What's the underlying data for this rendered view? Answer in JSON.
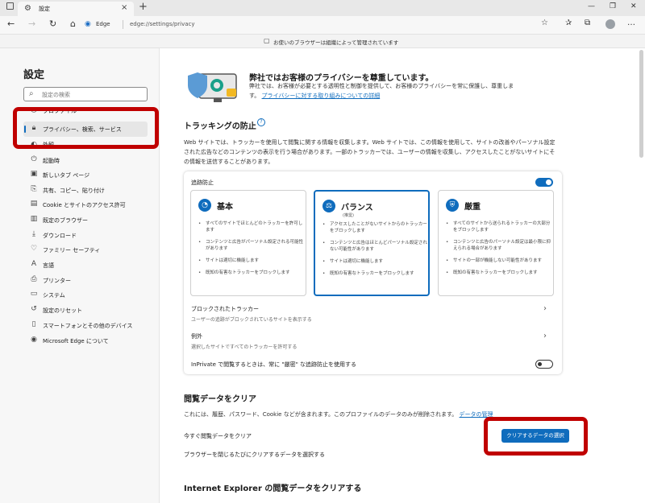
{
  "browser": {
    "tab_title": "設定",
    "address_host": "Edge",
    "address_url": "edge://settings/privacy",
    "managed_notice": "お使いのブラウザーは組織によって管理されています"
  },
  "sidebar": {
    "title": "設定",
    "search_placeholder": "設定の検索",
    "items": [
      {
        "label": "プロファイル",
        "icon": "profile-icon"
      },
      {
        "label": "プライバシー、検索、サービス",
        "icon": "lock-icon",
        "active": true
      },
      {
        "label": "外観",
        "icon": "appearance-icon"
      },
      {
        "label": "起動時",
        "icon": "power-icon"
      },
      {
        "label": "新しいタブ ページ",
        "icon": "newtab-icon"
      },
      {
        "label": "共有、コピー、貼り付け",
        "icon": "share-icon"
      },
      {
        "label": "Cookie とサイトのアクセス許可",
        "icon": "cookie-icon"
      },
      {
        "label": "既定のブラウザー",
        "icon": "browser-icon"
      },
      {
        "label": "ダウンロード",
        "icon": "download-icon"
      },
      {
        "label": "ファミリー セーフティ",
        "icon": "family-icon"
      },
      {
        "label": "言語",
        "icon": "language-icon"
      },
      {
        "label": "プリンター",
        "icon": "printer-icon"
      },
      {
        "label": "システム",
        "icon": "system-icon"
      },
      {
        "label": "設定のリセット",
        "icon": "reset-icon"
      },
      {
        "label": "スマートフォンとその他のデバイス",
        "icon": "phone-icon"
      },
      {
        "label": "Microsoft Edge について",
        "icon": "edge-icon"
      }
    ]
  },
  "hero": {
    "title": "弊社ではお客様のプライバシーを尊重しています。",
    "desc": "弊社では、お客様が必要とする透明性と制御を提供して、お客様のプライバシーを常に保護し、尊重します。",
    "link": "プライバシーに対する取り組みについての詳細"
  },
  "tracking": {
    "heading": "トラッキングの防止",
    "desc": "Web サイトでは、トラッカーを使用して閲覧に関する情報を収集します。Web サイトでは、この情報を使用して、サイトの改善やパーソナル設定された広告などのコンテンツの表示を行う場合があります。一部のトラッカーでは、ユーザーの情報を収集し、アクセスしたことがないサイトにその情報を送信することがあります。",
    "toggle_label": "追跡防止",
    "options": [
      {
        "name": "基本",
        "sub": "",
        "icon": "basic-icon",
        "bullets": [
          "すべてのサイトでほとんどのトラッカーを許可します",
          "コンテンツと広告がパーソナル設定される可能性があります",
          "サイトは適切に機能します",
          "既知の有害なトラッカーをブロックします"
        ]
      },
      {
        "name": "バランス",
        "sub": "(推奨)",
        "icon": "balance-icon",
        "bullets": [
          "アクセスしたことがないサイトからのトラッカーをブロックします",
          "コンテンツと広告はほとんどパーソナル設定されない可能性があります",
          "サイトは適切に機能します",
          "既知の有害なトラッカーをブロックします"
        ]
      },
      {
        "name": "厳重",
        "sub": "",
        "icon": "strict-icon",
        "bullets": [
          "すべてのサイトから送られるトラッカーの大部分をブロックします",
          "コンテンツと広告のパーソナル設定は最小限に抑えられる場合があります",
          "サイトの一部が機能しない可能性があります",
          "既知の有害なトラッカーをブロックします"
        ]
      }
    ],
    "blocked_title": "ブロックされたトラッカー",
    "blocked_sub": "ユーザーの追跡がブロックされているサイトを表示する",
    "exceptions_title": "例外",
    "exceptions_sub": "選択したサイトですべてのトラッカーを許可する",
    "inprivate_label": "InPrivate で閲覧するときは、常に \"厳密\" な追跡防止を使用する"
  },
  "clear": {
    "heading": "閲覧データをクリア",
    "desc": "これには、履歴、パスワード、Cookie などが含まれます。このプロファイルのデータのみが削除されます。",
    "link": "データの管理",
    "now_label": "今すぐ閲覧データをクリア",
    "button": "クリアするデータの選択",
    "onclose_label": "ブラウザーを閉じるたびにクリアするデータを選択する"
  },
  "ie": {
    "heading": "Internet Explorer の閲覧データをクリアする"
  }
}
